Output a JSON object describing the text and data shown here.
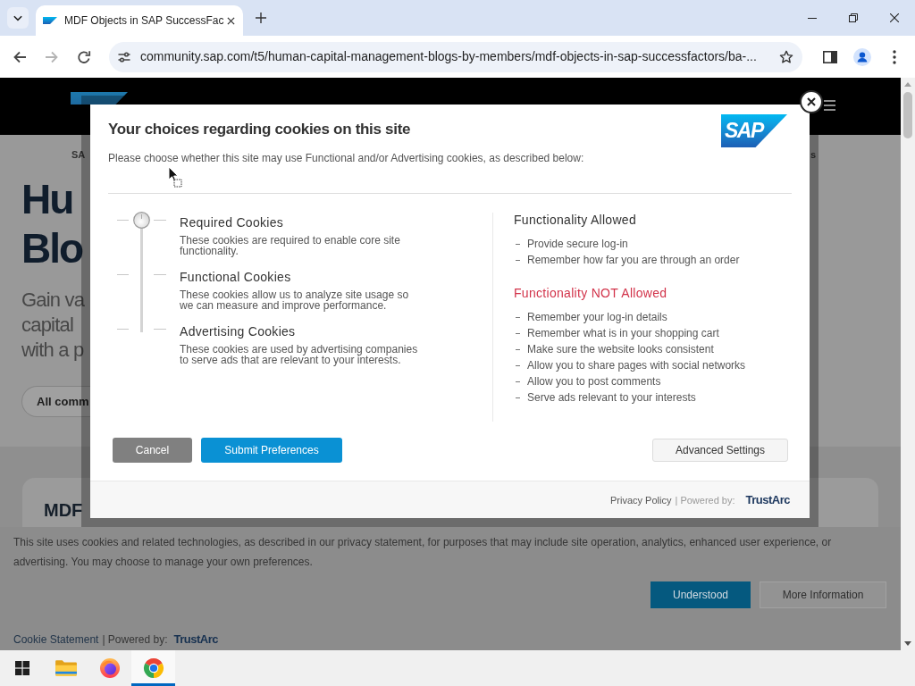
{
  "browser": {
    "tab": {
      "title": "MDF Objects in SAP SuccessFac"
    },
    "nav_buttons": [
      {
        "kind": "back",
        "disabled": false
      },
      {
        "kind": "forward",
        "disabled": true
      },
      {
        "kind": "reload",
        "disabled": false
      }
    ],
    "address": "community.sap.com/t5/human-capital-management-blogs-by-members/mdf-objects-in-sap-successfactors/ba-..."
  },
  "page": {
    "nav": [
      "SA",
      "s"
    ],
    "heading_lines": [
      "Hu",
      "Blo"
    ],
    "intro_lines": [
      "Gain va",
      "capital",
      "with a p"
    ],
    "filter_button": "All comm",
    "card_title": "MDF"
  },
  "cookie_dialog": {
    "title": "Your choices regarding cookies on this site",
    "intro": "Please choose whether this site may use Functional and/or Advertising cookies, as described below:",
    "logo": "SAP",
    "levels": [
      {
        "title": "Required Cookies",
        "description": "These cookies are required to enable core site functionality.",
        "selected": true
      },
      {
        "title": "Functional Cookies",
        "description": "These cookies allow us to analyze site usage so we can measure and improve performance.",
        "selected": false
      },
      {
        "title": "Advertising Cookies",
        "description": "These cookies are used by advertising companies to serve ads that are relevant to your interests.",
        "selected": false
      }
    ],
    "permissions": [
      {
        "kind": "allowed",
        "heading": "Functionality Allowed",
        "items": [
          "Provide secure log-in",
          "Remember how far you are through an order"
        ]
      },
      {
        "kind": "not_allowed",
        "heading": "Functionality NOT Allowed",
        "items": [
          "Remember your log-in details",
          "Remember what is in your shopping cart",
          "Make sure the website looks consistent",
          "Allow you to share pages with social networks",
          "Allow you to post comments",
          "Serve ads relevant to your interests"
        ]
      }
    ],
    "buttons": [
      {
        "label": "Cancel",
        "kind": "secondary"
      },
      {
        "label": "Submit Preferences",
        "kind": "primary"
      },
      {
        "label": "Advanced Settings",
        "kind": "tertiary"
      }
    ],
    "footer": {
      "privacy_link": "Privacy Policy",
      "powered_by": "| Powered by:",
      "brand": "TrustArc"
    }
  },
  "cookie_banner": {
    "text": "This site uses cookies and related technologies, as described in our privacy statement, for purposes that may include site operation, analytics, enhanced user experience, or advertising. You may choose to manage your own preferences.",
    "buttons": [
      {
        "label": "Understood",
        "kind": "primary"
      },
      {
        "label": "More Information",
        "kind": "secondary"
      }
    ],
    "footer": {
      "statement_link": "Cookie Statement",
      "powered_by": "| Powered by:",
      "brand": "TrustArc"
    }
  },
  "taskbar": {
    "apps": [
      {
        "kind": "folder",
        "selected": false
      },
      {
        "kind": "firefox",
        "selected": false
      },
      {
        "kind": "chrome",
        "selected": true
      }
    ]
  }
}
